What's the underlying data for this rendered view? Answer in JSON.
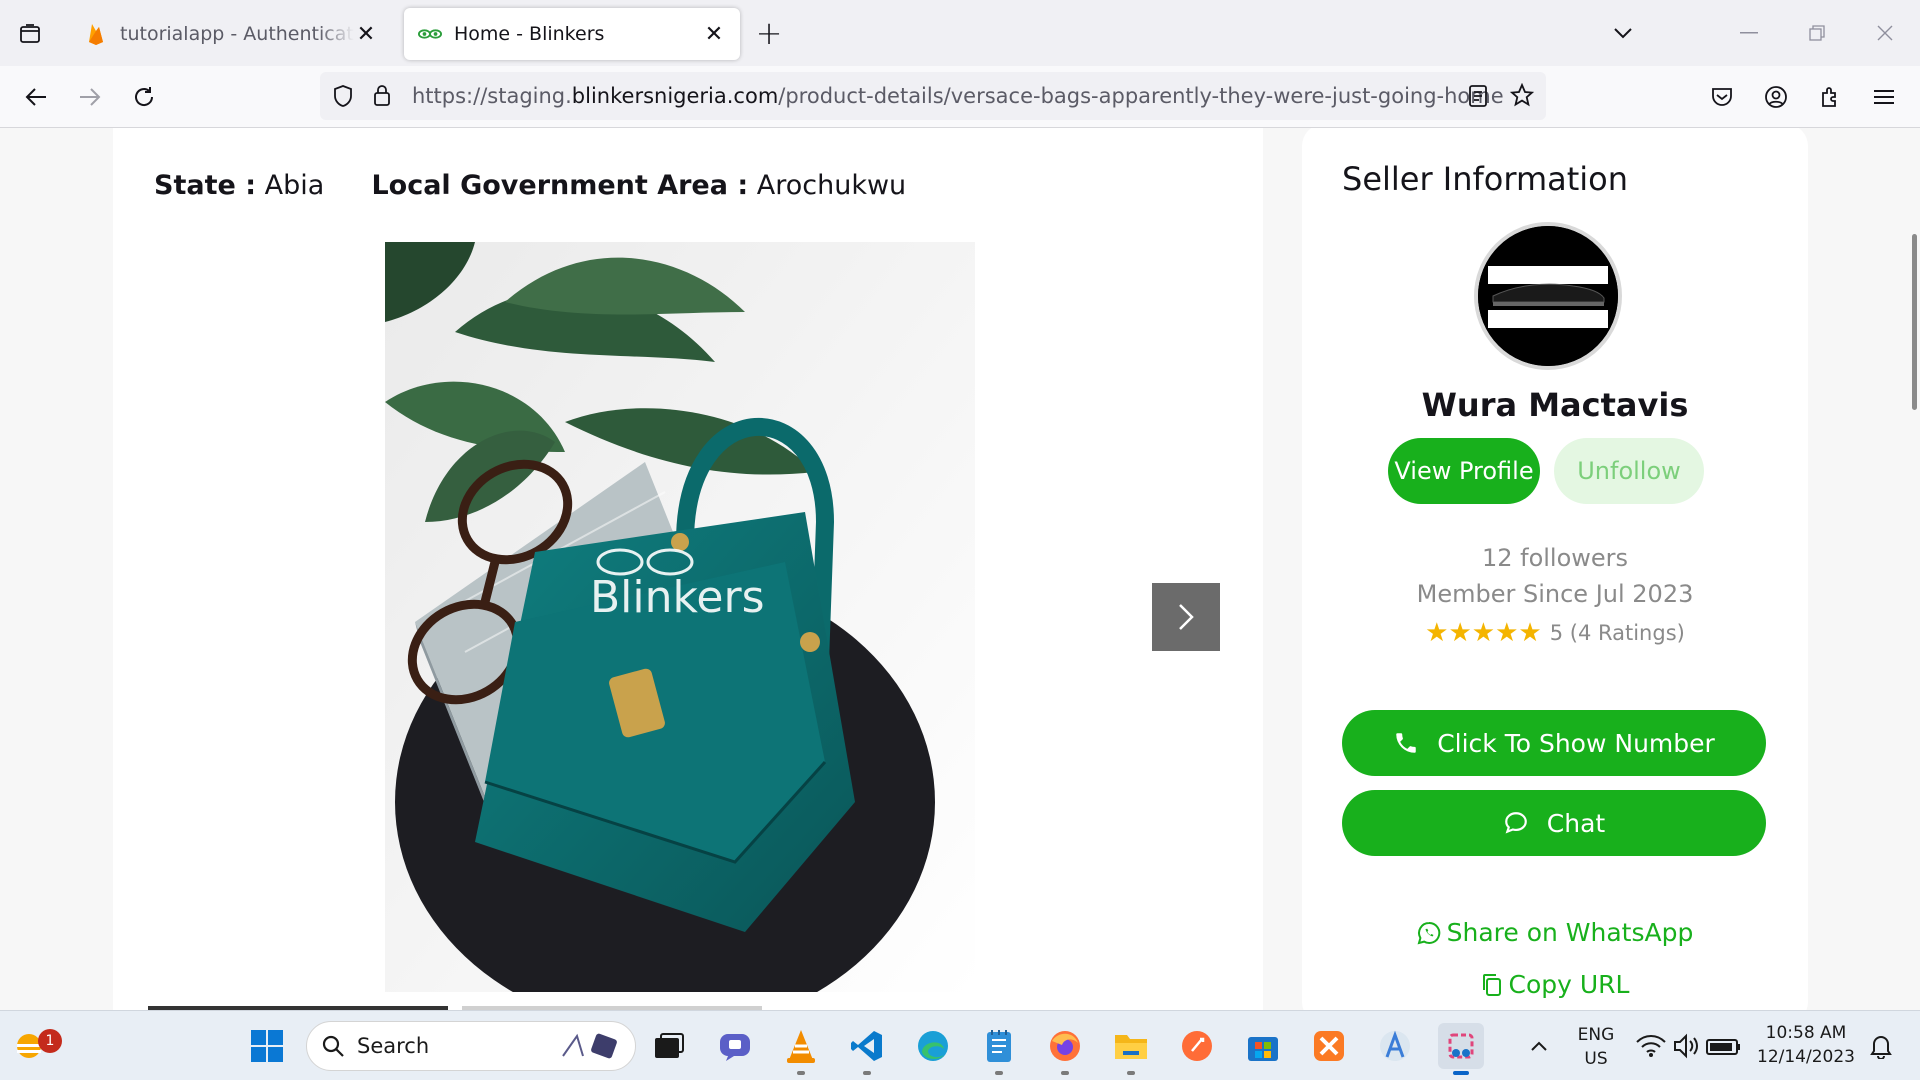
{
  "browser": {
    "tabs": [
      {
        "title": "tutorialapp - Authentication - Firebase",
        "active": false
      },
      {
        "title": "Home - Blinkers",
        "active": true
      }
    ],
    "url_prefix": "https://staging.",
    "url_host": "blinkersnigeria.com",
    "url_path": "/product-details/versace-bags-apparently-they-were-just-going-home"
  },
  "product": {
    "state_label": "State :",
    "state_value": "Abia",
    "lga_label": "Local Government Area :",
    "lga_value": "Arochukwu",
    "watermark": "Blinkers"
  },
  "seller": {
    "heading": "Seller Information",
    "name": "Wura Mactavis",
    "view_profile": "View Profile",
    "unfollow": "Unfollow",
    "followers": "12 followers",
    "member_since": "Member Since Jul 2023",
    "stars": 5,
    "rating_text": "5 (4 Ratings)",
    "show_number": "Click To Show Number",
    "chat": "Chat",
    "share_whatsapp": "Share on WhatsApp",
    "copy_url": "Copy URL"
  },
  "colors": {
    "brand_green": "#18b01c",
    "unfollow_bg": "#e4f7e2",
    "star": "#f4b400"
  },
  "taskbar": {
    "search_label": "Search",
    "notification_count": "1",
    "lang_1": "ENG",
    "lang_2": "US",
    "time": "10:58 AM",
    "date": "12/14/2023"
  }
}
